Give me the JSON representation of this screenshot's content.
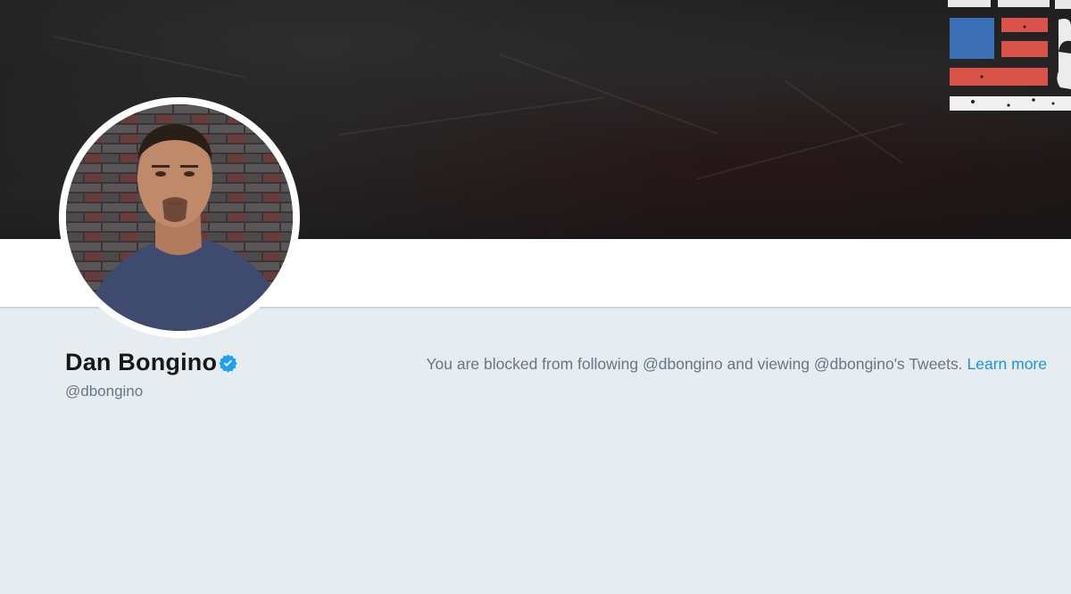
{
  "profile": {
    "name": "Dan Bongino",
    "handle": "@dbongino",
    "verified": true
  },
  "blocked_notice": {
    "message": "You are blocked from following @dbongino and viewing @dbongino's Tweets.",
    "link_label": "Learn more"
  },
  "colors": {
    "page_background": "#e6ecf0",
    "verified_badge": "#1da1f2",
    "link": "#1b95e0",
    "secondary_text": "#657786",
    "name_text": "#14171a",
    "flag_blue": "#3b6fb6",
    "flag_red": "#d9534a"
  },
  "icons": {
    "verified": "verified-badge-icon",
    "avatar": "profile-photo"
  }
}
